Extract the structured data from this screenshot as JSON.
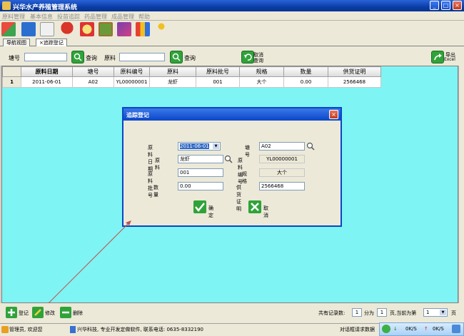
{
  "window": {
    "title": "兴华水产养殖管理系统"
  },
  "menu": [
    "原料管理",
    "基本信息",
    "投苗追踪",
    "药品管理",
    "成品管理",
    "帮助"
  ],
  "tabs": [
    {
      "label": "导航视图"
    },
    {
      "label": "追踪登记"
    }
  ],
  "search": {
    "pond_label": "塘号",
    "pond_value": "",
    "query_label_1": "查询",
    "material_label": "原料",
    "material_value": "",
    "query_label_2": "查询",
    "cancel_query_line1": "取消",
    "cancel_query_line2": "查询",
    "export_line1": "导出",
    "export_line2": "Excel"
  },
  "table": {
    "columns": [
      "原料日期",
      "塘号",
      "原料编号",
      "原料",
      "原料批号",
      "规格",
      "数量",
      "供货证明"
    ],
    "rows": [
      {
        "num": "1",
        "cells": [
          "2011-06-01",
          "A02",
          "YL00000001",
          "龙虾",
          "001",
          "大个",
          "0.00",
          "2566468"
        ]
      }
    ]
  },
  "dialog": {
    "title": "追踪登记",
    "date_label": "原料日期",
    "date_value": "2011-06-01",
    "pond_label": "塘号",
    "pond_value": "A02",
    "material_label": "原料",
    "material_value": "龙虾",
    "material_code_label": "原料编号",
    "material_code_value": "YL00000001",
    "batch_label": "原料批号",
    "batch_value": "001",
    "spec_label": "规格",
    "spec_value": "大个",
    "qty_label": "数量",
    "qty_value": "0.00",
    "cert_label": "供货证明",
    "cert_value": "2566468",
    "ok_label": "确定",
    "cancel_label": "取消"
  },
  "actions": {
    "register_label": "登记",
    "edit_label": "修改",
    "delete_label": "删除"
  },
  "pager": {
    "total_label": "共有记录数:",
    "total_value": "1",
    "split_label": "分为",
    "pages_value": "1",
    "current_label": "页,当前为第",
    "current_value": "1",
    "page_suffix": "页"
  },
  "status": {
    "user": "管理员, 欢迎您",
    "company": "兴华科技, 专业开发定做软件, 联系电话: 0635-8332190",
    "request": "对话框请求数据",
    "net_down": "0K/S",
    "net_up": "0K/S"
  },
  "colors": {
    "grid_bg": "#7ff4f4",
    "title_blue": "#0a46c8",
    "accent_green": "#2fa33a",
    "arrow_red": "#c0504d"
  }
}
